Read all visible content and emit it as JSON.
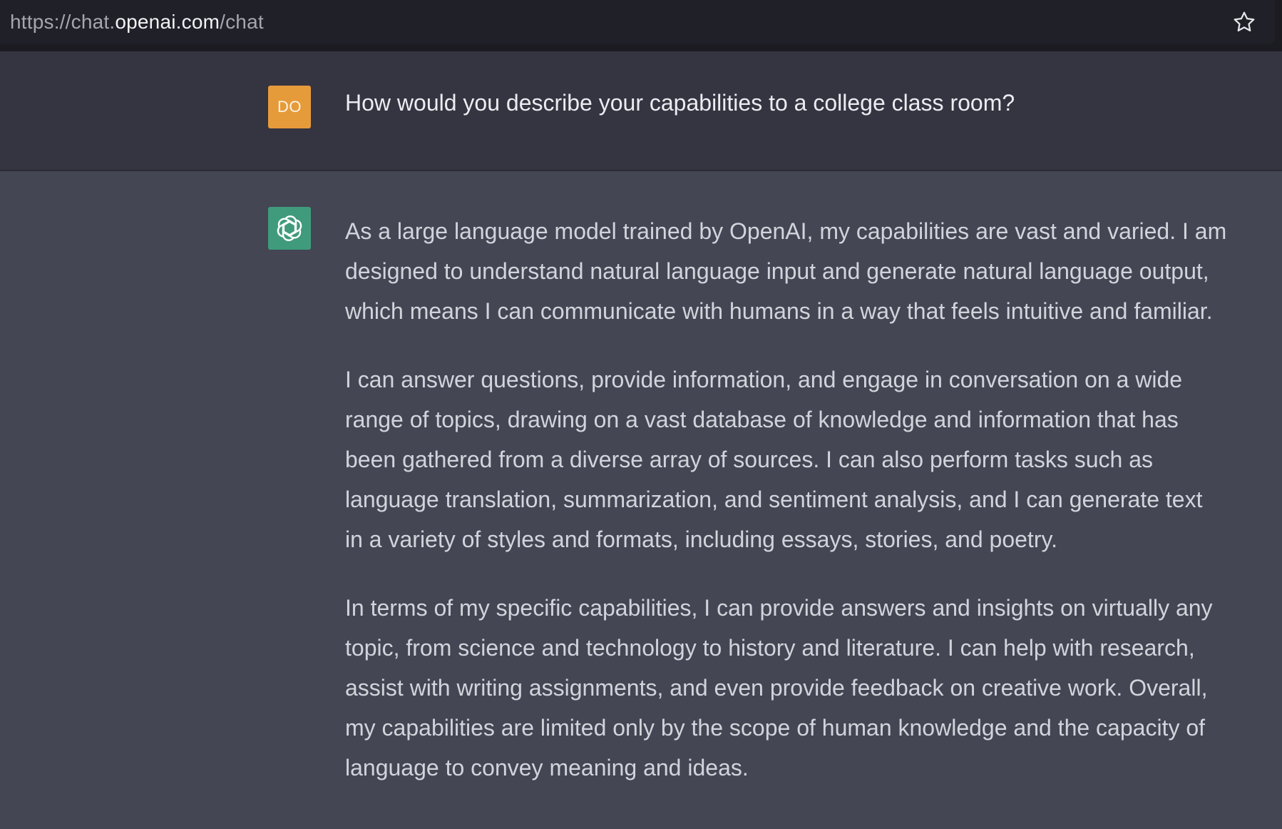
{
  "browser": {
    "url_prefix": "https://chat.",
    "url_domain": "openai.com",
    "url_path": "/chat",
    "bookmark_icon": "star-icon"
  },
  "conversation": {
    "user": {
      "avatar_initials": "DO",
      "avatar_color": "#e69b3a",
      "message": "How would you describe your capabilities to a college class room?"
    },
    "assistant": {
      "avatar_icon": "openai-logo-icon",
      "avatar_color": "#3f9b7c",
      "paragraphs": [
        {
          "lines": [
            "As a large language model trained by OpenAI, my capabilities are vast and varied. I am",
            "designed to understand natural language input and generate natural language output,",
            "which means I can communicate with humans in a way that feels intuitive and familiar."
          ]
        },
        {
          "lines": [
            "I can answer questions, provide information, and engage in conversation on a wide",
            "range of topics, drawing on a vast database of knowledge and information that has",
            "been gathered from a diverse array of sources. I can also perform tasks such as",
            "language translation, summarization, and sentiment analysis, and I can generate text",
            "in a variety of styles and formats, including essays, stories, and poetry."
          ]
        },
        {
          "lines": [
            "In terms of my specific capabilities, I can provide answers and insights on virtually any",
            "topic, from science and technology to history and literature. I can help with research,",
            "assist with writing assignments, and even provide feedback on creative work. Overall,",
            "my capabilities are limited only by the scope of human knowledge and the capacity of",
            "language to convey meaning and ideas."
          ]
        }
      ]
    }
  }
}
